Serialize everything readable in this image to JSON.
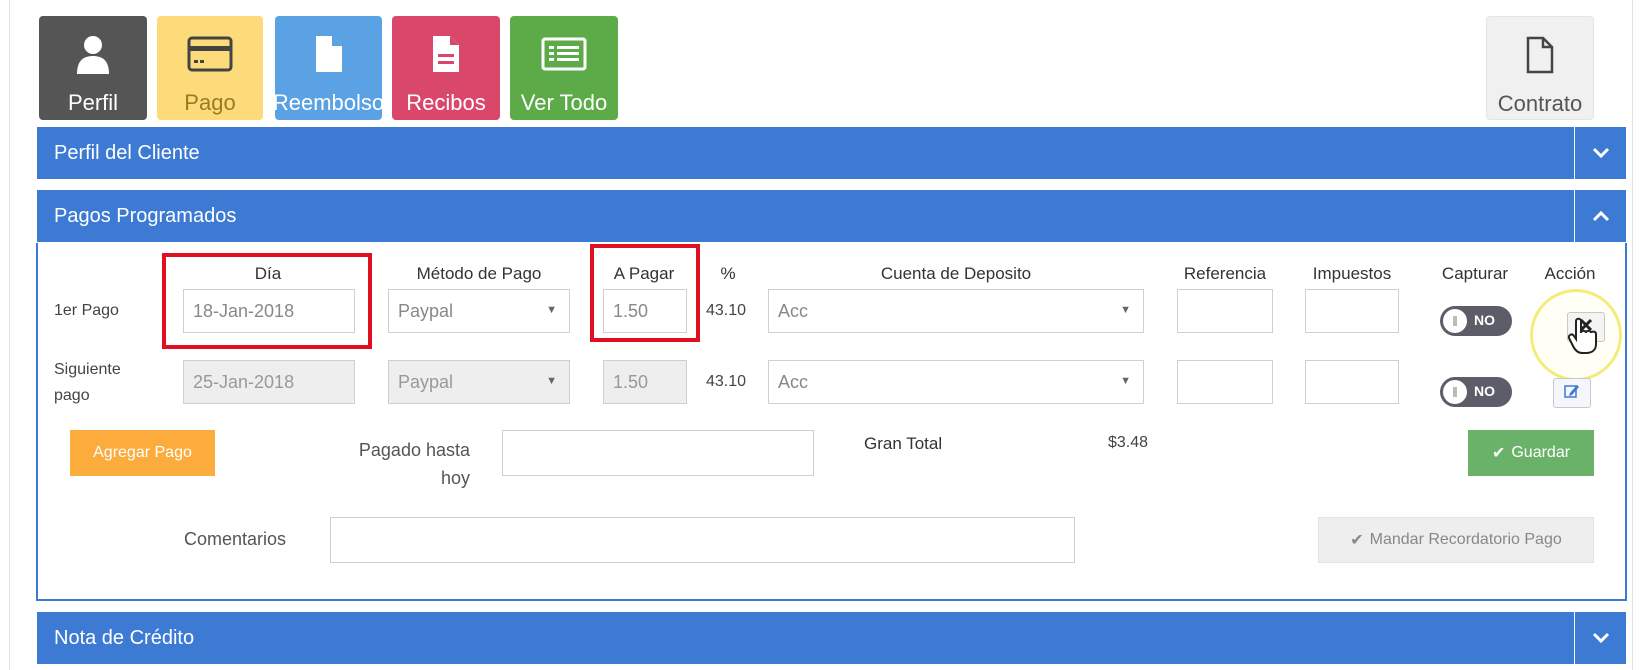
{
  "toolbar": {
    "perfil": "Perfil",
    "pago": "Pago",
    "reembolso": "Reembolso",
    "recibos": "Recibos",
    "ver_todo": "Ver Todo",
    "contrato": "Contrato"
  },
  "sections": {
    "perfil_cliente": "Perfil del Cliente",
    "pagos_programados": "Pagos Programados",
    "nota_credito": "Nota de Crédito"
  },
  "table": {
    "headers": {
      "dia": "Día",
      "metodo": "Método de Pago",
      "a_pagar": "A Pagar",
      "pct": "%",
      "cuenta": "Cuenta de Deposito",
      "referencia": "Referencia",
      "impuestos": "Impuestos",
      "capturar": "Capturar",
      "accion": "Acción"
    },
    "rows": [
      {
        "label": "1er Pago",
        "dia": "18-Jan-2018",
        "metodo": "Paypal",
        "a_pagar": "1.50",
        "pct": "43.10",
        "cuenta": "Acc",
        "referencia": "",
        "impuestos": "",
        "capturar": "NO"
      },
      {
        "label": "Siguiente pago",
        "dia": "25-Jan-2018",
        "metodo": "Paypal",
        "a_pagar": "1.50",
        "pct": "43.10",
        "cuenta": "Acc",
        "referencia": "",
        "impuestos": "",
        "capturar": "NO"
      }
    ]
  },
  "footer": {
    "agregar_pago": "Agregar Pago",
    "pagado_hasta_hoy": "Pagado hasta hoy",
    "pagado_value": "",
    "gran_total_label": "Gran Total",
    "gran_total_value": "$3.48",
    "guardar": "Guardar",
    "comentarios": "Comentarios",
    "comentarios_value": "",
    "mandar_recordatorio": "Mandar Recordatorio Pago"
  },
  "colors": {
    "section_bar": "#3d7ad4",
    "perfil": "#555555",
    "pago": "#fddb7a",
    "reembolso": "#5aa2e3",
    "recibos": "#d9476a",
    "ver_todo": "#5cab48",
    "agregar": "#fbac3c",
    "guardar": "#6ab26a",
    "highlight": "#e01020"
  }
}
